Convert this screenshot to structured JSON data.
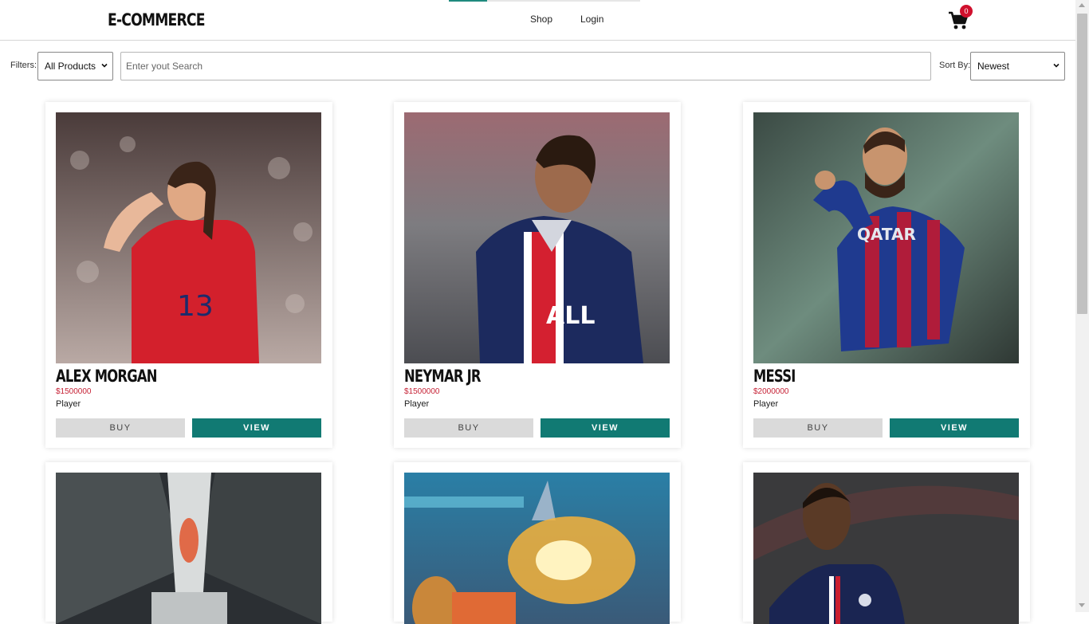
{
  "header": {
    "logo": "E-COMMERCE",
    "nav": [
      {
        "label": "Shop"
      },
      {
        "label": "Login"
      }
    ],
    "cart_count": "0",
    "accent_color": "#1f8a7e"
  },
  "filters": {
    "label": "Filters:",
    "selected": "All Products",
    "search_placeholder": "Enter yout Search",
    "sort_label": "Sort By:",
    "sort_selected": "Newest"
  },
  "products": [
    {
      "name": "ALEX MORGAN",
      "price": "$1500000",
      "category": "Player",
      "buy_label": "BUY",
      "view_label": "VIEW",
      "image": "player-photo"
    },
    {
      "name": "NEYMAR JR",
      "price": "$1500000",
      "category": "Player",
      "buy_label": "BUY",
      "view_label": "VIEW",
      "image": "player-photo"
    },
    {
      "name": "MESSI",
      "price": "$2000000",
      "category": "Player",
      "buy_label": "BUY",
      "view_label": "VIEW",
      "image": "player-photo"
    },
    {
      "image": "game-art-photo"
    },
    {
      "image": "game-art-photo"
    },
    {
      "image": "player-photo"
    }
  ],
  "colors": {
    "buy_button": "#dadada",
    "view_button": "#117a73",
    "price": "#c62236",
    "cart_badge": "#d0102d"
  }
}
